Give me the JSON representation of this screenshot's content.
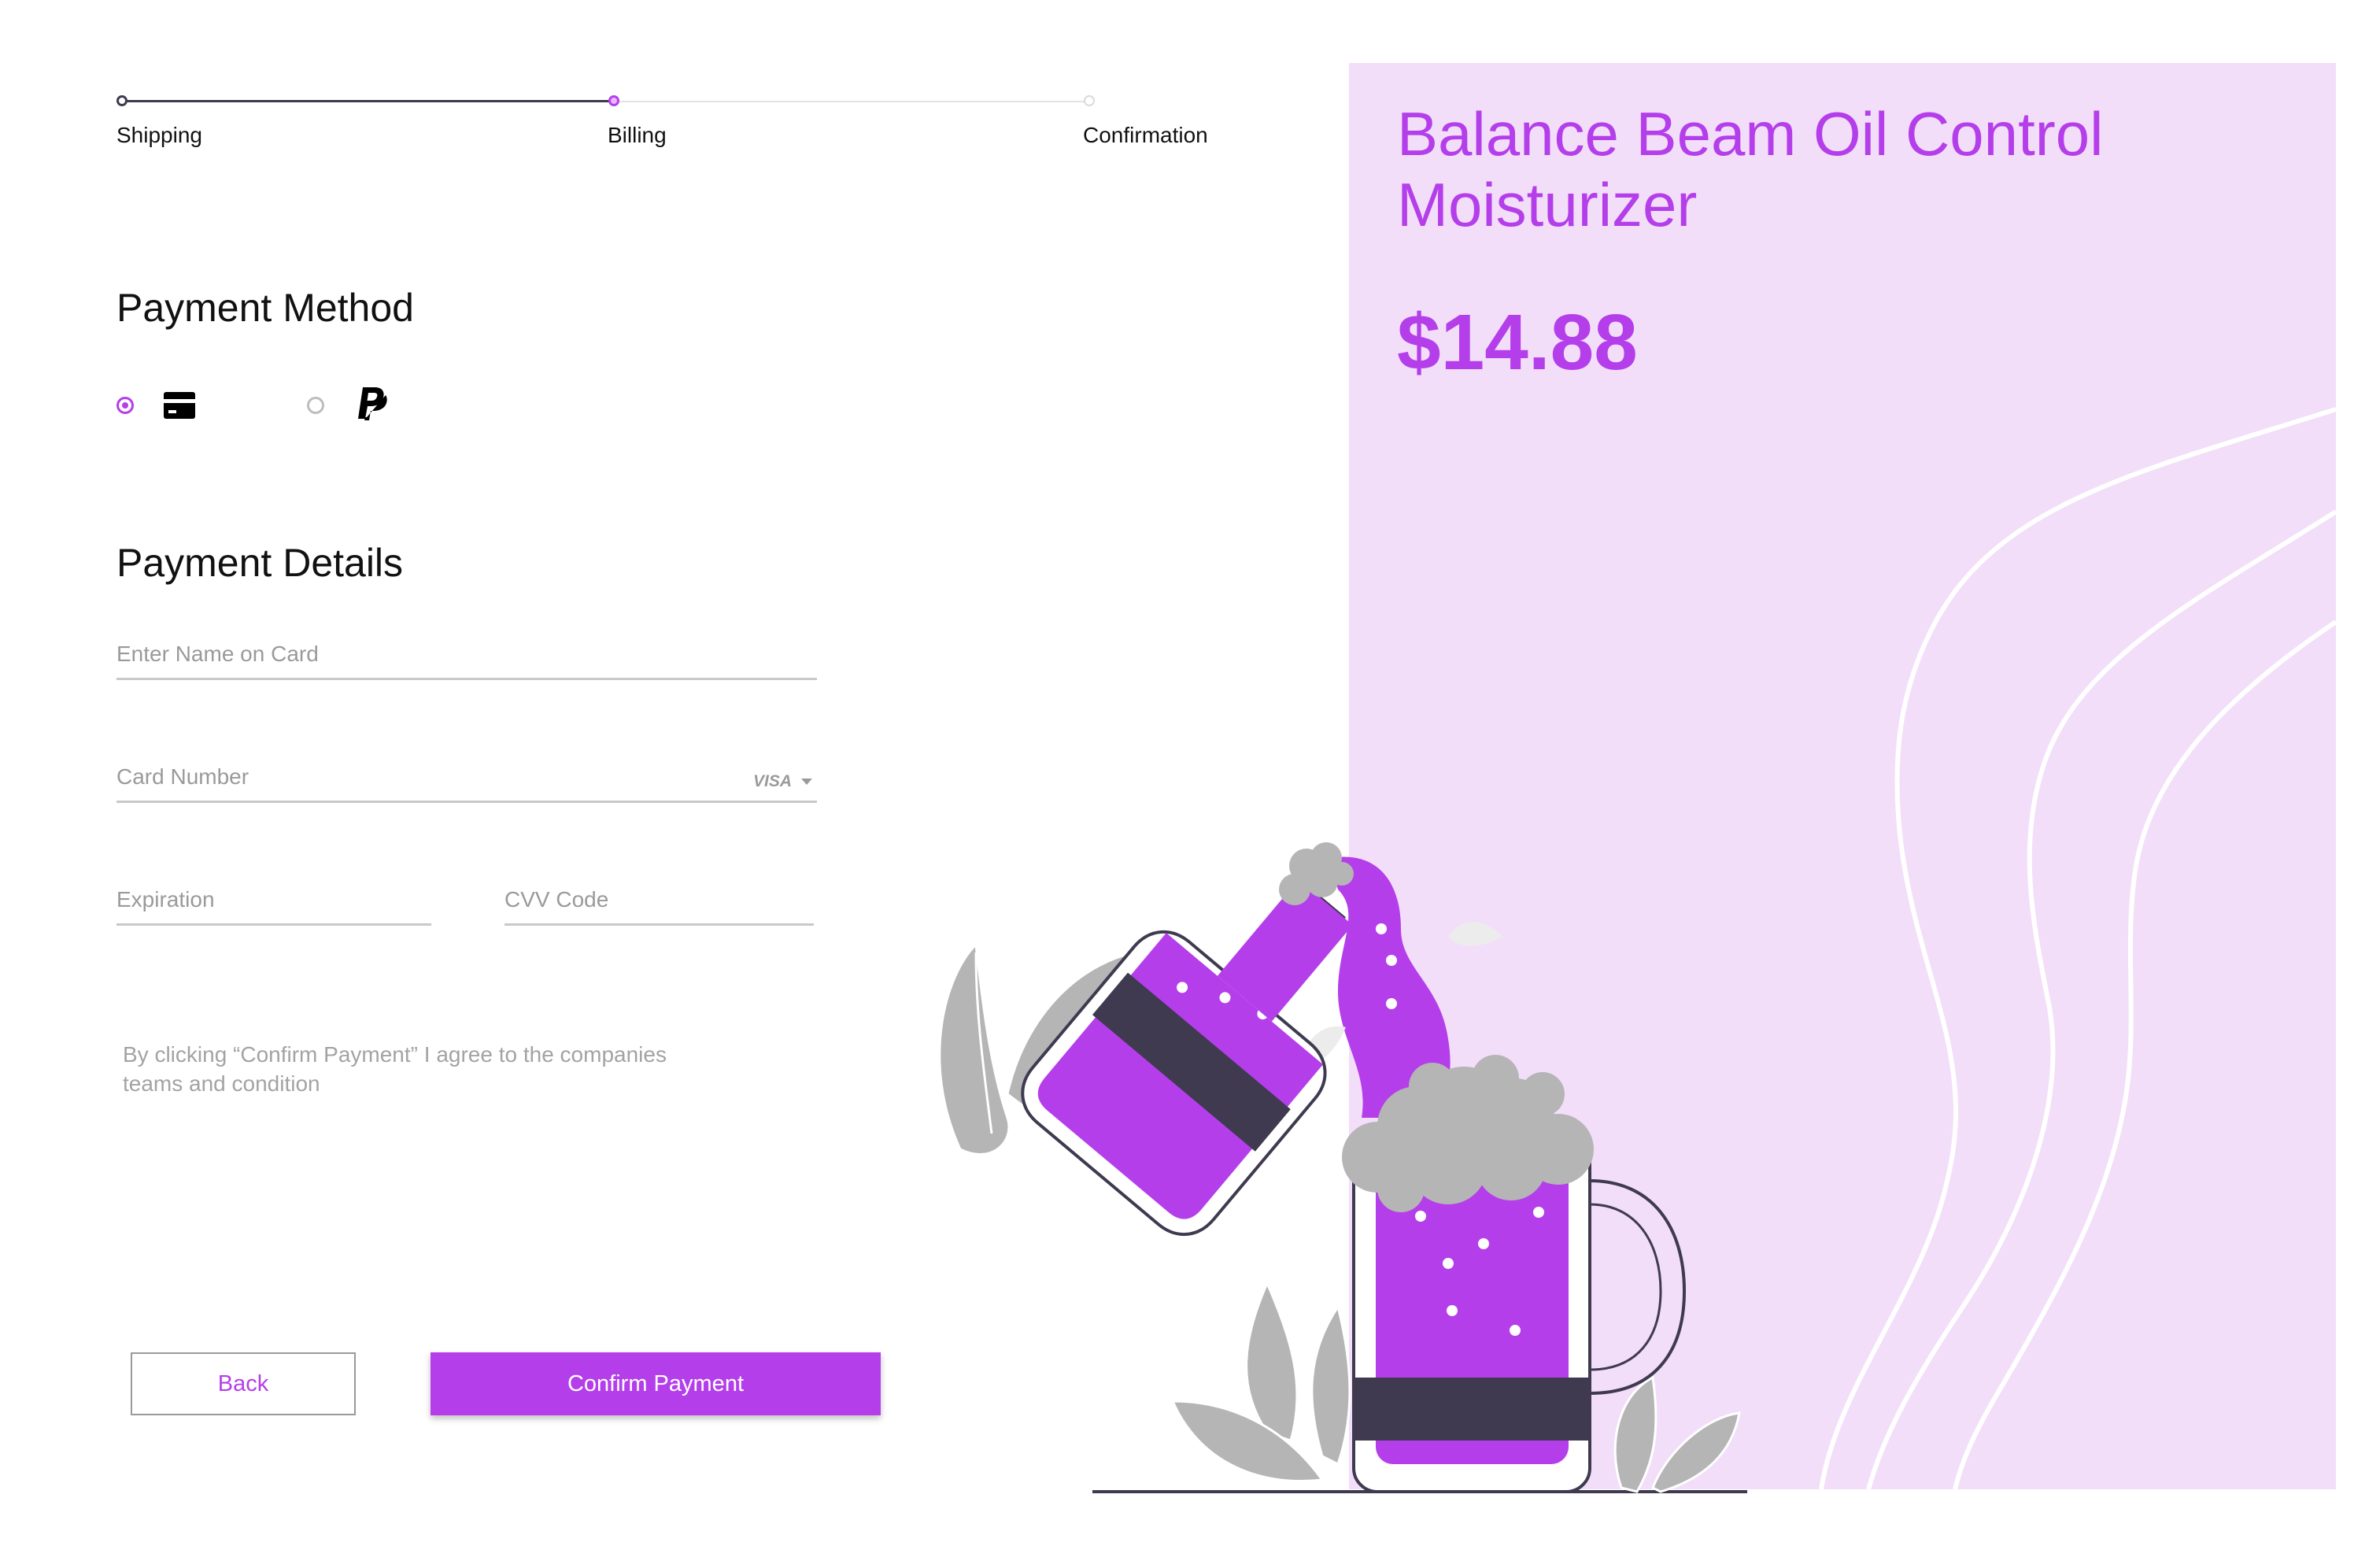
{
  "stepper": {
    "steps": [
      {
        "label": "Shipping",
        "state": "done"
      },
      {
        "label": "Billing",
        "state": "active"
      },
      {
        "label": "Confirmation",
        "state": "pending"
      }
    ]
  },
  "payment_method": {
    "title": "Payment Method",
    "options": [
      {
        "icon": "credit-card-icon",
        "selected": true
      },
      {
        "icon": "paypal-icon",
        "selected": false
      }
    ]
  },
  "payment_details": {
    "title": "Payment Details",
    "name_placeholder": "Enter Name on Card",
    "card_placeholder": "Card Number",
    "card_brand": "VISA",
    "expiration_placeholder": "Expiration",
    "cvv_placeholder": "CVV Code",
    "terms": "By clicking “Confirm Payment” I agree to the companies teams and condition"
  },
  "actions": {
    "back_label": "Back",
    "confirm_label": "Confirm Payment"
  },
  "product": {
    "name": "Balance Beam Oil Control Moisturizer",
    "price": "$14.88"
  },
  "colors": {
    "accent": "#b43fea",
    "panel": "#f3def9",
    "dark": "#3f3a50",
    "foam": "#b5b5b5"
  }
}
